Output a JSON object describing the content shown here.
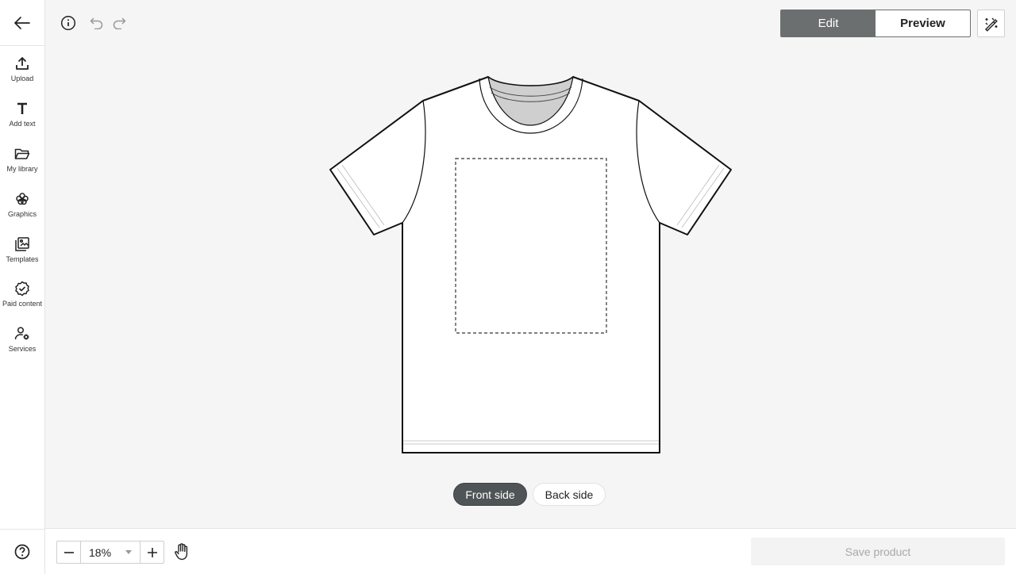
{
  "sidebar": {
    "back_icon": "arrow-left-icon",
    "items": [
      {
        "label": "Upload",
        "icon": "upload-icon"
      },
      {
        "label": "Add text",
        "icon": "text-icon"
      },
      {
        "label": "My library",
        "icon": "folder-icon"
      },
      {
        "label": "Graphics",
        "icon": "flower-icon"
      },
      {
        "label": "Templates",
        "icon": "templates-icon"
      },
      {
        "label": "Paid content",
        "icon": "badge-check-icon"
      },
      {
        "label": "Services",
        "icon": "user-gear-icon"
      }
    ],
    "help_icon": "help-icon"
  },
  "toolbar": {
    "mode_tabs": [
      {
        "label": "Edit",
        "active": true
      },
      {
        "label": "Preview",
        "active": false
      }
    ]
  },
  "canvas": {
    "sides": [
      {
        "label": "Front side",
        "active": true
      },
      {
        "label": "Back side",
        "active": false
      }
    ]
  },
  "bottom": {
    "zoom_value": "18%",
    "save_label": "Save product",
    "save_enabled": false
  },
  "colors": {
    "active_tab": "#6b6f70",
    "active_side": "#4f5456",
    "collar": "#cfcfcf"
  }
}
